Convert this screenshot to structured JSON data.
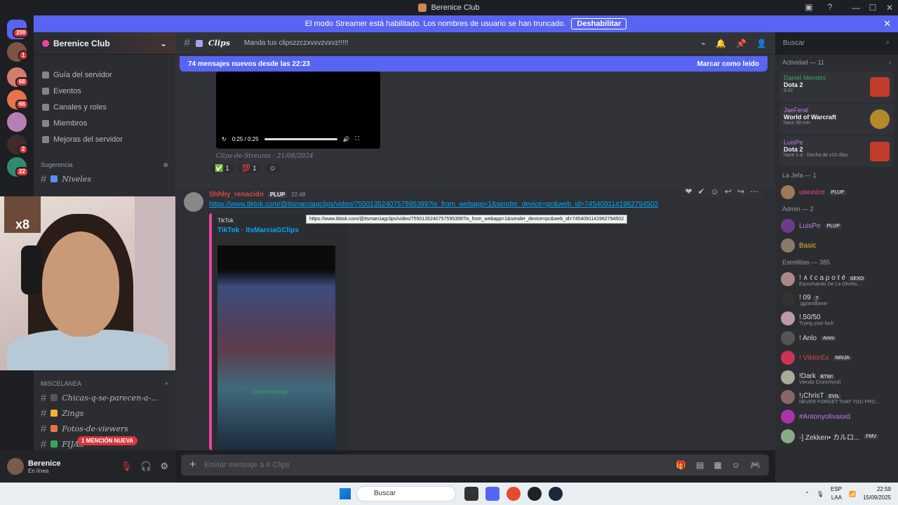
{
  "window": {
    "title": "Berenice Club"
  },
  "streamer_banner": {
    "text": "El modo Streamer está habilitado. Los nombres de usuario se han truncado.",
    "button": "Deshabilitar"
  },
  "guild_badges": [
    "200",
    "1",
    "68",
    "66",
    "2",
    "22"
  ],
  "server": {
    "name": "Berenice Club"
  },
  "sidebar": {
    "items": [
      {
        "label": "Guía del servidor"
      },
      {
        "label": "Eventos"
      },
      {
        "label": "Canales y roles"
      },
      {
        "label": "Miembros"
      },
      {
        "label": "Mejoras del servidor"
      }
    ],
    "suggestion_label": "Sugerencia",
    "suggested_channel": "Niveles",
    "category": "MISCELANEA",
    "channels": [
      {
        "name": "Chicas-q-se-parecen-a-..."
      },
      {
        "name": "Zings"
      },
      {
        "name": "Fotos-de-viewers"
      },
      {
        "name": "FIJAS"
      }
    ],
    "mention_pill": "1 MENCIÓN NUEVA"
  },
  "webcam": {
    "overlay": "x8"
  },
  "user": {
    "name": "Berenice",
    "status": "En línea"
  },
  "channel": {
    "name": "Clips",
    "topic": "Manda tus clipszzczxvxvzvxvz!!!!!"
  },
  "search": {
    "placeholder": "Buscar"
  },
  "new_messages": {
    "text": "74 mensajes nuevos desde las 22:23",
    "mark": "Marcar como leído"
  },
  "video": {
    "time": "0:25 / 0:25"
  },
  "prev_message": {
    "channel_tag": "Clips-de-Streams",
    "date": "21/08/2024",
    "reactions": [
      {
        "count": "1"
      },
      {
        "count": "1"
      }
    ]
  },
  "message": {
    "author": "Shhby_renacido",
    "tag": "PLUP",
    "time": "22:48",
    "link": "https://www.tiktok.com/@itsmarciagclips/video/7550135240757595399?is_from_webapp=1&sender_device=pc&web_id=7454091141962794502",
    "tooltip": "https://www.tiktok.com/@itsmarciagclips/video/7550135240757595399?is_from_webapp=1&sender_device=pc&web_id=7454091141962794502",
    "embed_provider": "TikTok",
    "embed_title": "TikTok · ItsMarciaGClips",
    "embed_caption": "Kick/itsmarciagc"
  },
  "composer": {
    "placeholder": "Enviar mensaje a #  Clips"
  },
  "activity": {
    "header": "Actividad — 11",
    "items": [
      {
        "user": "Daniel Mendes",
        "game": "Dota 2",
        "time": "8:01",
        "color": "#c23c2a"
      },
      {
        "user": "JaeFeral",
        "game": "World of Warcraft",
        "time": "hace 39 min",
        "color": "#b38a2a"
      },
      {
        "user": "LuisPe",
        "game": "Dota 2",
        "time": "hace 1 d · Racha de x10 días",
        "color": "#c23c2a"
      }
    ]
  },
  "roles": [
    {
      "header": "La Jefa — 1",
      "members": [
        {
          "name": "uwunice",
          "tag": "PLUP",
          "sub": "",
          "color": "#eb459f"
        }
      ]
    },
    {
      "header": "Admin — 2",
      "members": [
        {
          "name": "LuisPe",
          "tag": "PLUP",
          "sub": "",
          "color": "#c27ce5"
        },
        {
          "name": "Basic",
          "tag": "",
          "sub": "",
          "color": "#f0b232"
        }
      ]
    },
    {
      "header": "Estrellitas — 385",
      "members": [
        {
          "name": "! ∧ ℓ c a ρ o ℓ é",
          "tag": "SEXO",
          "sub": "Escuchando De La Ghetto,...",
          "color": "#dbdee1"
        },
        {
          "name": "! 09",
          "tag": "7",
          "sub": ".gg/antiflame",
          "color": "#dbdee1"
        },
        {
          "name": "!.50/50",
          "tag": "",
          "sub": "Trying your luck",
          "color": "#dbdee1"
        },
        {
          "name": "! Anlo",
          "tag": "Anmi",
          "sub": "",
          "color": "#dbdee1"
        },
        {
          "name": "! ViktorEx",
          "tag": "NINJA",
          "sub": "",
          "color": "#d14a4a"
        },
        {
          "name": "!Dark",
          "tag": "BTW!",
          "sub": "Viendo Crunchyroll",
          "color": "#dbdee1"
        },
        {
          "name": "!¡ChrisT",
          "tag": "EVIL",
          "sub": "NEVER FORGET THAT YOU PRO...",
          "color": "#dbdee1"
        },
        {
          "name": "#Antonyolivasxd",
          "tag": "",
          "sub": "",
          "color": "#c27ce5"
        },
        {
          "name": "-] Zekken• カルロ...",
          "tag": "FMV",
          "sub": "",
          "color": "#dbdee1"
        }
      ]
    }
  ],
  "taskbar": {
    "search": "Buscar",
    "lang": "ESP",
    "lang2": "LAA",
    "time": "22:59",
    "date": "15/09/2025"
  }
}
